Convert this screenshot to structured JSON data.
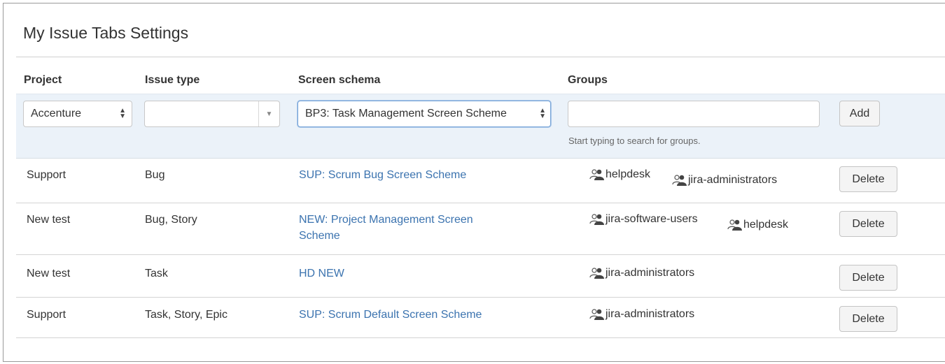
{
  "page": {
    "title": "My Issue Tabs Settings"
  },
  "columns": {
    "project": "Project",
    "issue_type": "Issue type",
    "screen_schema": "Screen schema",
    "groups": "Groups"
  },
  "form": {
    "project_value": "Accenture",
    "issue_type_value": "",
    "screen_schema_value": "BP3: Task Management Screen Scheme",
    "groups_value": "",
    "groups_hint": "Start typing to search for groups.",
    "add_label": "Add"
  },
  "rows": [
    {
      "project": "Support",
      "issue_type": "Bug",
      "schema": "SUP: Scrum Bug Screen Scheme",
      "schema_line2": "",
      "groups": [
        "helpdesk",
        "jira-administrators"
      ],
      "action": "Delete"
    },
    {
      "project": "New test",
      "issue_type": "Bug, Story",
      "schema": "NEW: Project Management Screen",
      "schema_line2": "Scheme",
      "groups": [
        "jira-software-users",
        "helpdesk"
      ],
      "action": "Delete"
    },
    {
      "project": "New test",
      "issue_type": "Task",
      "schema": "HD NEW",
      "schema_line2": "",
      "groups": [
        "jira-administrators"
      ],
      "action": "Delete"
    },
    {
      "project": "Support",
      "issue_type": "Task, Story, Epic",
      "schema": "SUP: Scrum Default Screen Scheme",
      "schema_line2": "",
      "groups": [
        "jira-administrators"
      ],
      "action": "Delete"
    }
  ],
  "icons": {
    "group": "group-icon",
    "select_arrows": "up-down-arrows-icon",
    "dropdown": "chevron-down-icon"
  },
  "colors": {
    "link": "#3b73af",
    "form_band": "#ebf2f9"
  }
}
